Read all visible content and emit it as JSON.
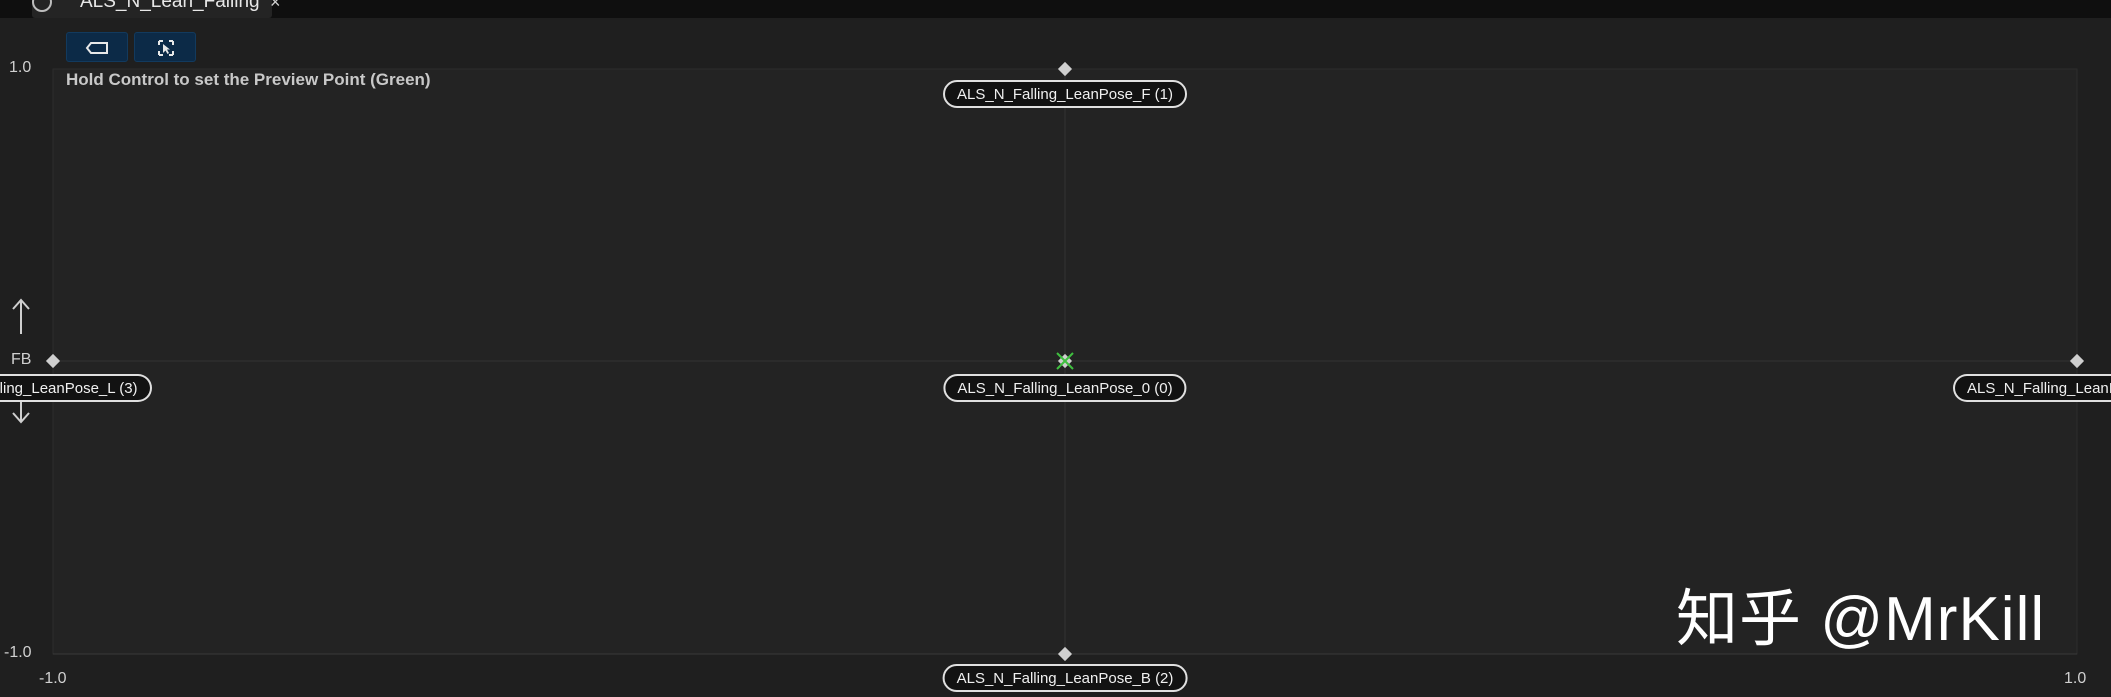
{
  "tab": {
    "title": "ALS_N_Lean_Falling",
    "close_glyph": "×",
    "icon": "info-icon"
  },
  "toolbar": {
    "buttons": [
      {
        "name": "tag-icon"
      },
      {
        "name": "select-cursor-icon"
      }
    ]
  },
  "hint": "Hold Control to set the Preview Point (Green)",
  "axes": {
    "vertical_name": "FB",
    "y_max": "1.0",
    "y_min": "-1.0",
    "x_min": "-1.0",
    "x_max": "1.0"
  },
  "samples": [
    {
      "label": "ALS_N_Falling_LeanPose_F (1)"
    },
    {
      "label": "alling_LeanPose_L (3)"
    },
    {
      "label": "ALS_N_Falling_LeanPose_0 (0)"
    },
    {
      "label": "ALS_N_Falling_LeanI"
    },
    {
      "label": "ALS_N_Falling_LeanPose_B (2)"
    }
  ],
  "watermark": "知乎 @MrKill",
  "colors": {
    "grid_bg": "#232323",
    "preview_point": "#3fbf3f",
    "toolbar_button": "#0c2a47"
  }
}
